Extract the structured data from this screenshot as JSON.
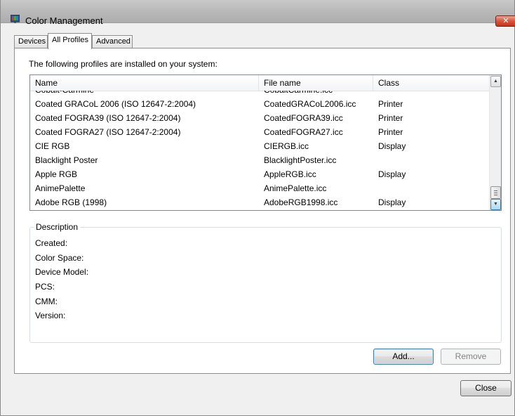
{
  "window": {
    "title": "Color Management",
    "close_glyph": "✕"
  },
  "tabs": [
    {
      "label": "Devices"
    },
    {
      "label": "All Profiles"
    },
    {
      "label": "Advanced"
    }
  ],
  "profiles": {
    "intro": "The following profiles are installed on your system:",
    "columns": {
      "name": "Name",
      "file": "File name",
      "class": "Class"
    },
    "rows": [
      {
        "name": "Cobalt-Carmine",
        "file": "CobaltCarmine.icc",
        "class": ""
      },
      {
        "name": "Coated GRACoL 2006 (ISO 12647-2:2004)",
        "file": "CoatedGRACoL2006.icc",
        "class": "Printer"
      },
      {
        "name": "Coated FOGRA39 (ISO 12647-2:2004)",
        "file": "CoatedFOGRA39.icc",
        "class": "Printer"
      },
      {
        "name": "Coated FOGRA27 (ISO 12647-2:2004)",
        "file": "CoatedFOGRA27.icc",
        "class": "Printer"
      },
      {
        "name": "CIE RGB",
        "file": "CIERGB.icc",
        "class": "Display"
      },
      {
        "name": "Blacklight Poster",
        "file": "BlacklightPoster.icc",
        "class": ""
      },
      {
        "name": "Apple RGB",
        "file": "AppleRGB.icc",
        "class": "Display"
      },
      {
        "name": "AnimePalette",
        "file": "AnimePalette.icc",
        "class": ""
      },
      {
        "name": "Adobe RGB (1998)",
        "file": "AdobeRGB1998.icc",
        "class": "Display"
      }
    ],
    "scroll_up_glyph": "▲",
    "scroll_down_glyph": "▼"
  },
  "description": {
    "legend": "Description",
    "fields": [
      {
        "label": "Created:"
      },
      {
        "label": "Color Space:"
      },
      {
        "label": "Device Model:"
      },
      {
        "label": "PCS:"
      },
      {
        "label": "CMM:"
      },
      {
        "label": "Version:"
      }
    ]
  },
  "buttons": {
    "add": "Add...",
    "remove": "Remove",
    "close": "Close"
  },
  "icons": {
    "app": "color-management-icon",
    "close": "close-icon"
  }
}
